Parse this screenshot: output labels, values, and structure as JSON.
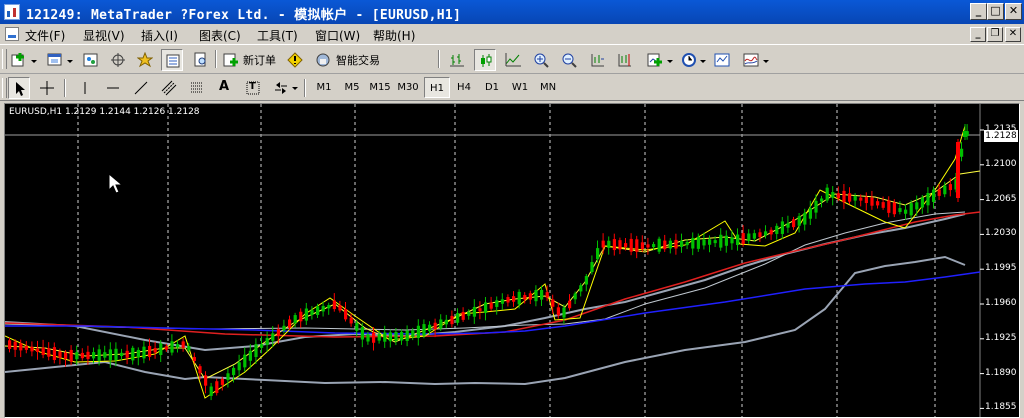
{
  "window": {
    "title": "121249: MetaTrader ?Forex Ltd. - 模拟帐户 - [EURUSD,H1]",
    "minimize_glyph": "_",
    "maximize_glyph": "□",
    "close_glyph": "✕"
  },
  "menu": {
    "items": [
      "文件(F)",
      "显视(V)",
      "插入(I)",
      "图表(C)",
      "工具(T)",
      "窗口(W)",
      "帮助(H)"
    ],
    "mdi_minimize": "_",
    "mdi_restore": "❐",
    "mdi_close": "✕"
  },
  "toolbar": {
    "new_order_label": "新订单",
    "expert_label": "智能交易"
  },
  "timeframes": {
    "items": [
      "M1",
      "M5",
      "M15",
      "M30",
      "H1",
      "H4",
      "D1",
      "W1",
      "MN"
    ],
    "active": "H1"
  },
  "drawing_tools": {
    "text_glyph": "A",
    "label_glyph": "T"
  },
  "chart": {
    "info": "EURUSD,H1  1.2129 1.2144 1.2126 1.2128",
    "current_price": "1.2128",
    "price_levels": [
      "1.2135",
      "1.2100",
      "1.2065",
      "1.2030",
      "1.1995",
      "1.1960",
      "1.1925",
      "1.1890",
      "1.1855"
    ],
    "colors": {
      "background": "#000000",
      "bull_candle": "#00c000",
      "bear_candle": "#ff0000",
      "bollinger": "#9aa4b4",
      "ma_slow": "#2020ff",
      "ma_mid": "#e02020",
      "ma_fast": "#ffff40",
      "zigzag": "#ffff00"
    }
  }
}
